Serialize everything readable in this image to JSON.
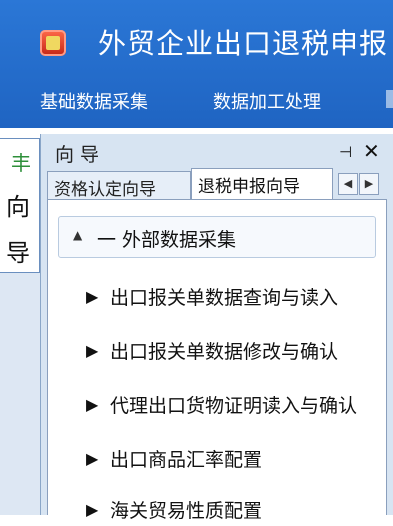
{
  "app": {
    "title": "外贸企业出口退税申报",
    "menu": [
      "基础数据采集",
      "数据加工处理"
    ]
  },
  "left_panel": {
    "icon": "tree-icon",
    "label_chars": [
      "向",
      "导"
    ]
  },
  "guide_panel": {
    "title": "向 导",
    "pin_glyph": "⊣",
    "close_glyph": "✕",
    "tabs": [
      {
        "label": "资格认定向导",
        "active": false
      },
      {
        "label": "退税申报向导",
        "active": true
      }
    ],
    "tab_nav": {
      "prev": "◀",
      "next": "▶"
    },
    "section": {
      "caret": "▲",
      "label": "一 外部数据采集"
    },
    "items": [
      {
        "label": "出口报关单数据查询与读入"
      },
      {
        "label": "出口报关单数据修改与确认"
      },
      {
        "label": "代理出口货物证明读入与确认"
      },
      {
        "label": "出口商品汇率配置"
      },
      {
        "label": "海关贸易性质配置"
      }
    ],
    "item_arrow": "▶"
  },
  "colors": {
    "header_blue": "#2b77d6",
    "panel_bg": "#d7e4f2"
  }
}
